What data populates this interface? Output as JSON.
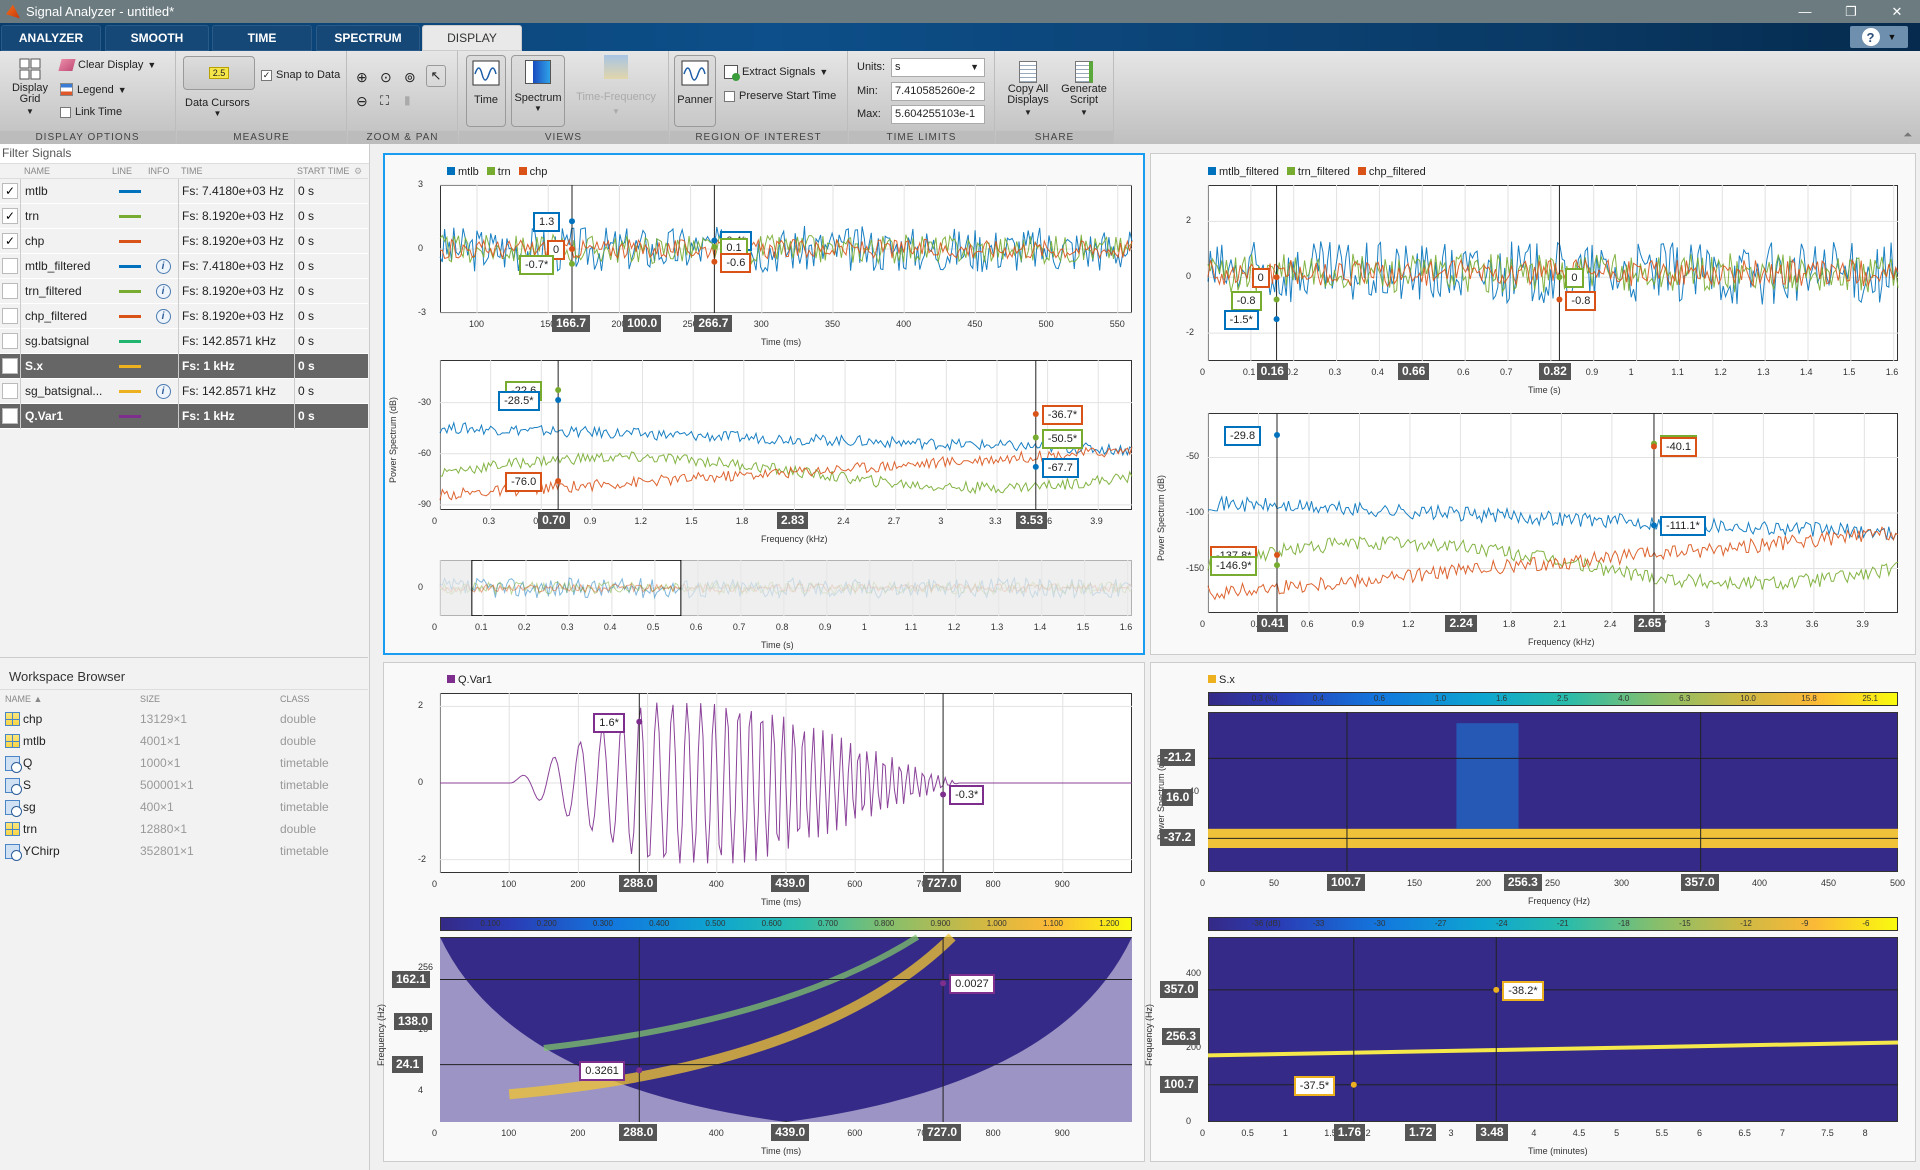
{
  "window": {
    "title": "Signal Analyzer - untitled*",
    "minimize": "—",
    "restore": "❐",
    "close": "✕"
  },
  "tabs": [
    {
      "label": "ANALYZER"
    },
    {
      "label": "SMOOTH"
    },
    {
      "label": "TIME"
    },
    {
      "label": "SPECTRUM"
    },
    {
      "label": "DISPLAY",
      "active": true
    }
  ],
  "help": {
    "label": "?"
  },
  "toolstrip": {
    "display_options": {
      "label": "DISPLAY OPTIONS",
      "display_grid": "Display Grid",
      "clear_display": "Clear Display",
      "legend": "Legend",
      "link_time": "Link Time",
      "link_time_checked": false
    },
    "measure": {
      "label": "MEASURE",
      "data_cursors": "Data Cursors",
      "data_cursors_icon_text": "2.5",
      "snap_to_data": "Snap to Data",
      "snap_checked": true
    },
    "zoom_pan": {
      "label": "ZOOM & PAN"
    },
    "views": {
      "label": "VIEWS",
      "time": "Time",
      "spectrum": "Spectrum",
      "time_frequency": "Time-Frequency"
    },
    "roi": {
      "label": "REGION OF INTEREST",
      "panner": "Panner",
      "extract_signals": "Extract Signals",
      "preserve_start_time": "Preserve Start Time",
      "preserve_checked": false
    },
    "time_limits": {
      "label": "TIME LIMITS",
      "units_label": "Units:",
      "units_value": "s",
      "min_label": "Min:",
      "min_value": "7.410585260e-2",
      "max_label": "Max:",
      "max_value": "5.604255103e-1"
    },
    "share": {
      "label": "SHARE",
      "copy_all": "Copy All Displays",
      "generate_script": "Generate Script"
    }
  },
  "signals": {
    "filter_placeholder": "Filter Signals",
    "headers": [
      "NAME",
      "LINE",
      "INFO",
      "TIME",
      "START TIME"
    ],
    "rows": [
      {
        "checked": true,
        "name": "mtlb",
        "color": "#0072bd",
        "info": false,
        "time": "Fs: 7.4180e+03 Hz",
        "start": "0 s",
        "selected": false
      },
      {
        "checked": true,
        "name": "trn",
        "color": "#77ac30",
        "info": false,
        "time": "Fs: 8.1920e+03 Hz",
        "start": "0 s",
        "selected": false
      },
      {
        "checked": true,
        "name": "chp",
        "color": "#d95319",
        "info": false,
        "time": "Fs: 8.1920e+03 Hz",
        "start": "0 s",
        "selected": false
      },
      {
        "checked": false,
        "name": "mtlb_filtered",
        "color": "#0072bd",
        "info": true,
        "time": "Fs: 7.4180e+03 Hz",
        "start": "0 s",
        "selected": false
      },
      {
        "checked": false,
        "name": "trn_filtered",
        "color": "#77ac30",
        "info": true,
        "time": "Fs: 8.1920e+03 Hz",
        "start": "0 s",
        "selected": false
      },
      {
        "checked": false,
        "name": "chp_filtered",
        "color": "#d95319",
        "info": true,
        "time": "Fs: 8.1920e+03 Hz",
        "start": "0 s",
        "selected": false
      },
      {
        "checked": false,
        "name": "sg.batsignal",
        "color": "#20b46e",
        "info": false,
        "time": "Fs: 142.8571 kHz",
        "start": "0 s",
        "selected": false
      },
      {
        "checked": false,
        "name": "S.x",
        "color": "#edb120",
        "info": false,
        "time": "Fs: 1 kHz",
        "start": "0 s",
        "selected": true
      },
      {
        "checked": false,
        "name": "sg_batsignal...",
        "color": "#edb120",
        "info": true,
        "time": "Fs: 142.8571 kHz",
        "start": "0 s",
        "selected": false
      },
      {
        "checked": false,
        "name": "Q.Var1",
        "color": "#7e2f8e",
        "info": false,
        "time": "Fs: 1 kHz",
        "start": "0 s",
        "selected": true
      }
    ]
  },
  "workspace": {
    "title": "Workspace Browser",
    "headers": [
      "NAME ▲",
      "SIZE",
      "CLASS"
    ],
    "rows": [
      {
        "name": "chp",
        "size": "13129×1",
        "class": "double",
        "icon": "matrix-icon"
      },
      {
        "name": "mtlb",
        "size": "4001×1",
        "class": "double",
        "icon": "matrix-icon"
      },
      {
        "name": "Q",
        "size": "1000×1",
        "class": "timetable",
        "icon": "timetable-icon"
      },
      {
        "name": "S",
        "size": "500001×1",
        "class": "timetable",
        "icon": "timetable-icon"
      },
      {
        "name": "sg",
        "size": "400×1",
        "class": "timetable",
        "icon": "timetable-icon"
      },
      {
        "name": "trn",
        "size": "12880×1",
        "class": "double",
        "icon": "matrix-icon"
      },
      {
        "name": "YChirp",
        "size": "352801×1",
        "class": "timetable",
        "icon": "timetable-icon"
      }
    ]
  },
  "chart_data": [
    {
      "id": "p1_time",
      "type": "line",
      "title": "",
      "xlabel": "Time (ms)",
      "ylabel": "",
      "legend": [
        {
          "name": "mtlb",
          "color": "#0072bd"
        },
        {
          "name": "trn",
          "color": "#77ac30"
        },
        {
          "name": "chp",
          "color": "#d95319"
        }
      ],
      "xlim": [
        74,
        560
      ],
      "ylim": [
        -3,
        3
      ],
      "xticks": [
        100,
        150,
        200,
        250,
        300,
        350,
        400,
        450,
        500,
        550
      ],
      "yticks": [
        -3,
        0,
        3
      ],
      "cursors_x": [
        {
          "value": 166.7,
          "label": "166.7"
        },
        {
          "value": 266.7,
          "label": "266.7"
        }
      ],
      "cursor_delta": "100.0",
      "datatips": [
        {
          "x": 166.7,
          "y": 1.3,
          "text": "1.3",
          "color": "#0072bd",
          "side": "left"
        },
        {
          "x": 166.7,
          "y": 0,
          "text": "0",
          "color": "#d95319",
          "side": "left"
        },
        {
          "x": 166.7,
          "y": -0.7,
          "text": "-0.7*",
          "color": "#77ac30",
          "side": "left"
        },
        {
          "x": 266.7,
          "y": 0.4,
          "text": "0.4*",
          "color": "#0072bd",
          "side": "right"
        },
        {
          "x": 266.7,
          "y": 0.1,
          "text": "0.1",
          "color": "#77ac30",
          "side": "right"
        },
        {
          "x": 266.7,
          "y": -0.6,
          "text": "-0.6",
          "color": "#d95319",
          "side": "right"
        }
      ]
    },
    {
      "id": "p1_spec",
      "type": "line",
      "xlabel": "Frequency (kHz)",
      "ylabel": "Power Spectrum (dB)",
      "xlim": [
        0,
        4.1
      ],
      "ylim": [
        -93,
        -5
      ],
      "xticks": [
        0,
        0.3,
        0.6,
        0.9,
        1.2,
        1.5,
        1.8,
        2.1,
        2.4,
        2.7,
        3.0,
        3.3,
        3.6,
        3.9
      ],
      "yticks": [
        -90,
        -60,
        -30
      ],
      "cursors_x": [
        {
          "value": 0.7,
          "label": "0.70"
        },
        {
          "value": 3.53,
          "label": "3.53"
        }
      ],
      "cursor_delta": "2.83",
      "datatips": [
        {
          "x": 0.7,
          "y": -22.6,
          "text": "-22.6",
          "color": "#77ac30",
          "side": "left"
        },
        {
          "x": 0.7,
          "y": -28.5,
          "text": "-28.5*",
          "color": "#0072bd",
          "side": "left"
        },
        {
          "x": 0.7,
          "y": -76.0,
          "text": "-76.0",
          "color": "#d95319",
          "side": "left"
        },
        {
          "x": 3.53,
          "y": -36.7,
          "text": "-36.7*",
          "color": "#d95319",
          "side": "right"
        },
        {
          "x": 3.53,
          "y": -50.5,
          "text": "-50.5*",
          "color": "#77ac30",
          "side": "right"
        },
        {
          "x": 3.53,
          "y": -67.7,
          "text": "-67.7",
          "color": "#0072bd",
          "side": "right"
        }
      ]
    },
    {
      "id": "p1_panner",
      "type": "line",
      "xlabel": "Time (s)",
      "xlim": [
        0,
        1.61
      ],
      "ylim": [
        -1,
        1
      ],
      "xticks": [
        0,
        0.1,
        0.2,
        0.3,
        0.4,
        0.5,
        0.6,
        0.7,
        0.8,
        0.9,
        1.0,
        1.1,
        1.2,
        1.3,
        1.4,
        1.5,
        1.6
      ],
      "yticks": [
        0
      ],
      "selection": [
        0.0741,
        0.5604
      ]
    },
    {
      "id": "p2_time",
      "type": "line",
      "xlabel": "Time (s)",
      "legend": [
        {
          "name": "mtlb_filtered",
          "color": "#0072bd"
        },
        {
          "name": "trn_filtered",
          "color": "#77ac30"
        },
        {
          "name": "chp_filtered",
          "color": "#d95319"
        }
      ],
      "xlim": [
        0,
        1.61
      ],
      "ylim": [
        -3,
        3.3
      ],
      "xticks": [
        0,
        0.1,
        0.2,
        0.3,
        0.4,
        0.5,
        0.6,
        0.7,
        0.8,
        0.9,
        1.0,
        1.1,
        1.2,
        1.3,
        1.4,
        1.5,
        1.6
      ],
      "yticks": [
        -2,
        0,
        2
      ],
      "cursors_x": [
        {
          "value": 0.16,
          "label": "0.16"
        },
        {
          "value": 0.82,
          "label": "0.82"
        }
      ],
      "cursor_delta": "0.66",
      "datatips": [
        {
          "x": 0.16,
          "y": 0,
          "text": "0",
          "color": "#d95319",
          "side": "left"
        },
        {
          "x": 0.16,
          "y": -0.8,
          "text": "-0.8",
          "color": "#77ac30",
          "side": "left"
        },
        {
          "x": 0.16,
          "y": -1.5,
          "text": "-1.5*",
          "color": "#0072bd",
          "side": "left"
        },
        {
          "x": 0.82,
          "y": 0,
          "text": "0",
          "color": "#77ac30",
          "side": "right"
        },
        {
          "x": 0.82,
          "y": -0.8,
          "text": "-0.8",
          "color": "#d95319",
          "side": "right"
        }
      ]
    },
    {
      "id": "p2_spec",
      "type": "line",
      "xlabel": "Frequency (kHz)",
      "ylabel": "Power Spectrum (dB)",
      "xlim": [
        0,
        4.1
      ],
      "ylim": [
        -190,
        -10
      ],
      "xticks": [
        0,
        0.3,
        0.6,
        0.9,
        1.2,
        1.5,
        1.8,
        2.1,
        2.4,
        2.7,
        3.0,
        3.3,
        3.6,
        3.9
      ],
      "yticks": [
        -150,
        -100,
        -50
      ],
      "cursors_x": [
        {
          "value": 0.41,
          "label": "0.41"
        },
        {
          "value": 2.65,
          "label": "2.65"
        }
      ],
      "cursor_delta": "2.24",
      "datatips": [
        {
          "x": 0.41,
          "y": -29.8,
          "text": "-29.8",
          "color": "#0072bd",
          "side": "left"
        },
        {
          "x": 0.41,
          "y": -137.8,
          "text": "-137.8*",
          "color": "#d95319",
          "side": "left"
        },
        {
          "x": 0.41,
          "y": -146.9,
          "text": "-146.9*",
          "color": "#77ac30",
          "side": "left"
        },
        {
          "x": 2.65,
          "y": -37.6,
          "text": "-37.6",
          "color": "#77ac30",
          "side": "right"
        },
        {
          "x": 2.65,
          "y": -40.1,
          "text": "-40.1",
          "color": "#d95319",
          "side": "right"
        },
        {
          "x": 2.65,
          "y": -111.1,
          "text": "-111.1*",
          "color": "#0072bd",
          "side": "right"
        }
      ]
    },
    {
      "id": "p3_time",
      "type": "line",
      "xlabel": "Time (ms)",
      "legend": [
        {
          "name": "Q.Var1",
          "color": "#7e2f8e"
        }
      ],
      "xlim": [
        0,
        1000
      ],
      "ylim": [
        -2.35,
        2.35
      ],
      "xticks": [
        0,
        100,
        200,
        300,
        400,
        500,
        600,
        700,
        800,
        900
      ],
      "yticks": [
        -2,
        0,
        2
      ],
      "cursors_x": [
        {
          "value": 288.0,
          "label": "288.0"
        },
        {
          "value": 727.0,
          "label": "727.0"
        }
      ],
      "cursor_delta": "439.0",
      "datatips": [
        {
          "x": 288.0,
          "y": 1.6,
          "text": "1.6*",
          "color": "#7e2f8e",
          "side": "left"
        },
        {
          "x": 727.0,
          "y": -0.3,
          "text": "-0.3*",
          "color": "#7e2f8e",
          "side": "right"
        }
      ]
    },
    {
      "id": "p3_scalogram",
      "type": "heatmap",
      "xlabel": "Time (ms)",
      "ylabel": "Frequency (Hz)",
      "colorbar_ticks": [
        "0.100",
        "0.200",
        "0.300",
        "0.400",
        "0.500",
        "0.600",
        "0.700",
        "0.800",
        "0.900",
        "1.000",
        "1.100",
        "1.200"
      ],
      "xlim": [
        0,
        1000
      ],
      "xticks": [
        0,
        100,
        200,
        300,
        400,
        500,
        600,
        700,
        800,
        900
      ],
      "yticks": [
        "4",
        "16",
        "256"
      ],
      "cursors_x": [
        {
          "value": 288.0,
          "label": "288.0"
        },
        {
          "value": 727.0,
          "label": "727.0"
        }
      ],
      "cursor_delta": "439.0",
      "cursors_y": [
        {
          "label": "162.1"
        },
        {
          "label": "24.1"
        }
      ],
      "cursor_y_delta": "138.0",
      "datatips": [
        {
          "text": "0.3261",
          "color": "#7e2f8e",
          "side": "left"
        },
        {
          "text": "0.0027",
          "color": "#7e2f8e",
          "side": "right"
        }
      ]
    },
    {
      "id": "p4_persistence",
      "type": "heatmap",
      "xlabel": "Frequency (Hz)",
      "ylabel": "Power Spectrum (dB)",
      "legend": [
        {
          "name": "S.x",
          "color": "#edb120"
        }
      ],
      "colorbar_ticks": [
        "0.3 (%)",
        "0.4",
        "0.6",
        "1.0",
        "1.6",
        "2.5",
        "4.0",
        "6.3",
        "10.0",
        "15.8",
        "25.1"
      ],
      "xlim": [
        0,
        500
      ],
      "xticks": [
        0,
        50,
        100,
        150,
        200,
        250,
        300,
        350,
        400,
        450,
        500
      ],
      "yticks": [
        "-40"
      ],
      "cursors_x": [
        {
          "value": 100.7,
          "label": "100.7"
        },
        {
          "value": 357.0,
          "label": "357.0"
        }
      ],
      "cursor_delta": "256.3",
      "cursors_y": [
        {
          "label": "-21.2"
        },
        {
          "label": "-37.2"
        }
      ],
      "cursor_y_delta": "16.0"
    },
    {
      "id": "p4_spectrogram",
      "type": "heatmap",
      "xlabel": "Time (minutes)",
      "ylabel": "Frequency (Hz)",
      "colorbar_ticks": [
        "-36 (dB)",
        "-33",
        "-30",
        "-27",
        "-24",
        "-21",
        "-18",
        "-15",
        "-12",
        "-9",
        "-6"
      ],
      "xlim": [
        0,
        8.33
      ],
      "xticks": [
        0,
        0.5,
        1.0,
        1.5,
        2.0,
        2.5,
        3.0,
        3.5,
        4.0,
        4.5,
        5.0,
        5.5,
        6.0,
        6.5,
        7.0,
        7.5,
        8.0
      ],
      "ylim": [
        0,
        500
      ],
      "yticks": [
        0,
        200,
        400
      ],
      "cursors_x": [
        {
          "value": 1.76,
          "label": "1.76"
        },
        {
          "value": 3.48,
          "label": "3.48"
        }
      ],
      "cursor_delta": "1.72",
      "cursors_y": [
        {
          "value": 357.0,
          "label": "357.0"
        },
        {
          "value": 100.7,
          "label": "100.7"
        }
      ],
      "cursor_y_delta": "256.3",
      "datatips": [
        {
          "text": "-38.2*",
          "color": "#edb120",
          "side": "right"
        },
        {
          "text": "-37.5*",
          "color": "#edb120",
          "side": "left"
        }
      ]
    }
  ]
}
